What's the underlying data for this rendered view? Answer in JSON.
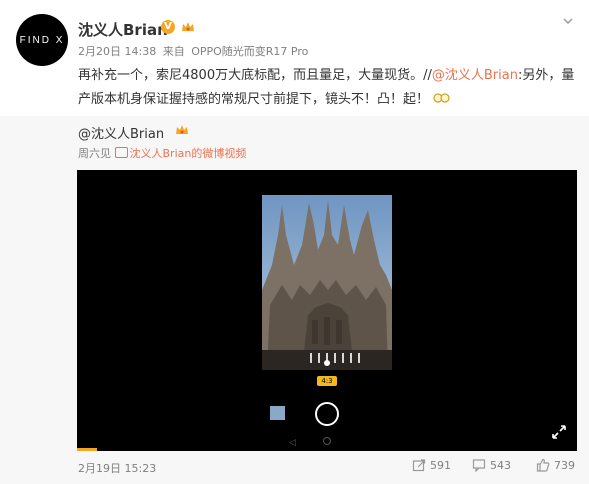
{
  "post": {
    "avatar_text": "FIND X",
    "username": "沈义人Brian",
    "verified_badge": "V",
    "date": "2月20日 14:38",
    "source_prefix": "来自",
    "source": "OPPO随光而变R17 Pro",
    "text_part1": "再补充一个，索尼4800万大底标配，而且量足，大量现货。//",
    "mention": "@沈义人Brian",
    "text_part2": ":另外，量产版本机身保证握持感的常规尺寸前提下，镜头不！凸！起！"
  },
  "repost": {
    "username": "@沈义人Brian",
    "meta_day": "周六见",
    "video_link": "沈义人Brian的微博视频",
    "ratio_label": "4:3"
  },
  "footer": {
    "date": "2月19日 15:23",
    "forward_count": "591",
    "comment_count": "543",
    "like_count": "739"
  },
  "colors": {
    "accent": "#eb7350",
    "badge": "#f5a623",
    "muted": "#808080"
  }
}
